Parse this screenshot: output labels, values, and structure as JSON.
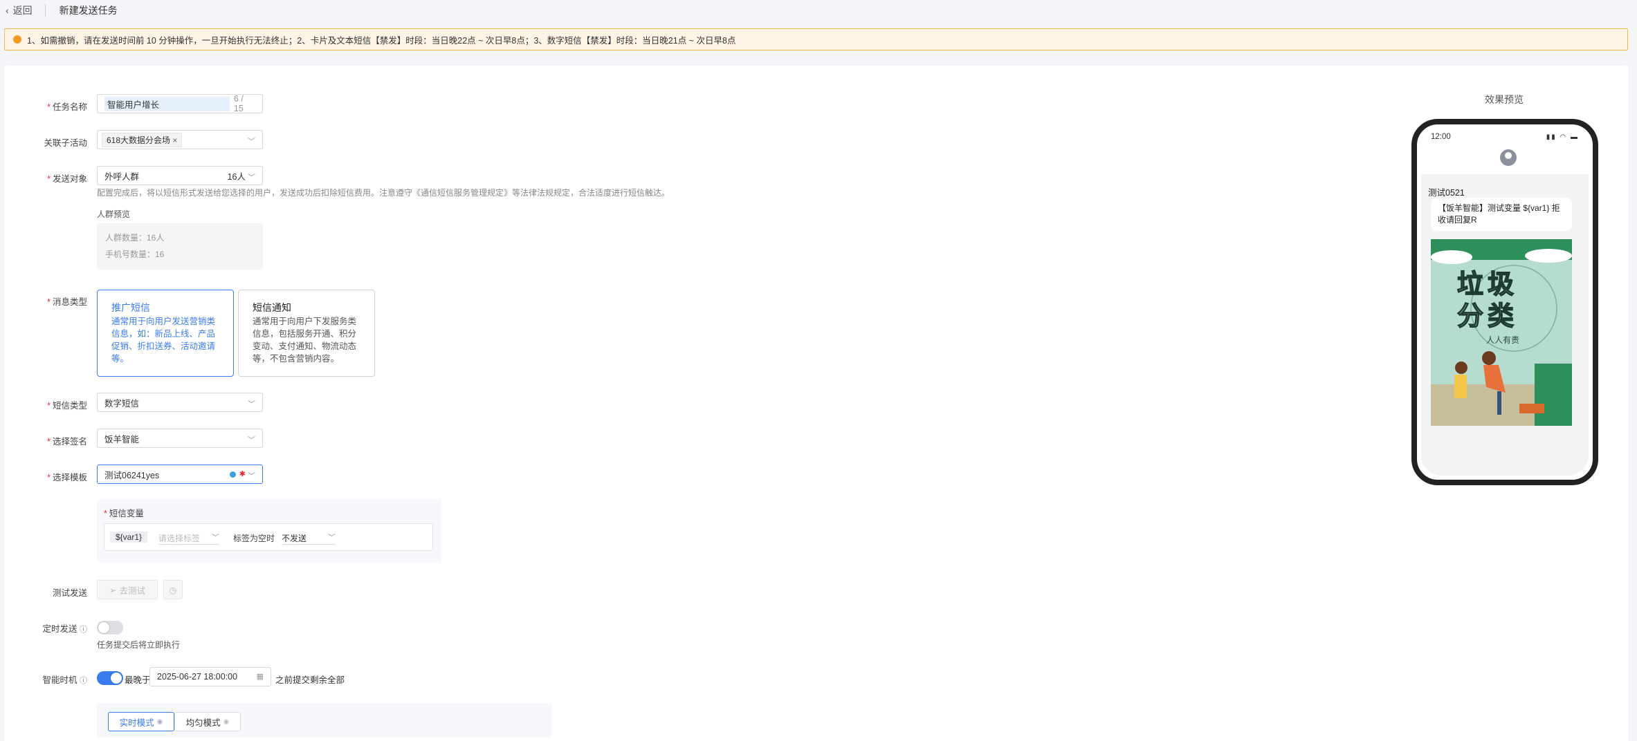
{
  "topbar": {
    "back_label": "返回",
    "title": "新建发送任务"
  },
  "alert": {
    "text": "1、如需撤销，请在发送时间前 10 分钟操作，一旦开始执行无法终止；2、卡片及文本短信【禁发】时段：当日晚22点 ~ 次日早8点；3、数字短信【禁发】时段：当日晚21点 ~ 次日早8点"
  },
  "form": {
    "task_name": {
      "label": "任务名称",
      "value": "智能用户增长",
      "count": "6 / 15"
    },
    "sub_activity": {
      "label": "关联子活动",
      "tag": "618大数据分会场"
    },
    "target": {
      "label": "发送对象",
      "value": "外呼人群",
      "count": "16人",
      "hint": "配置完成后，将以短信形式发送给您选择的用户，发送成功后扣除短信费用。注意遵守《通信短信服务管理规定》等法律法规规定，合法适度进行短信触达。",
      "preview_title": "人群预览",
      "people_count": "人群数量：16人",
      "phone_count": "手机号数量：16"
    },
    "msg_type": {
      "label": "消息类型",
      "options": [
        {
          "title": "推广短信",
          "desc": "通常用于向用户发送营销类信息，如：新品上线、产品促销、折扣送券、活动邀请等。"
        },
        {
          "title": "短信通知",
          "desc": "通常用于向用户下发服务类信息，包括服务开通、积分变动、支付通知、物流动态等，不包含营销内容。"
        }
      ]
    },
    "sms_type": {
      "label": "短信类型",
      "value": "数字短信"
    },
    "signature": {
      "label": "选择签名",
      "value": "饭羊智能"
    },
    "template": {
      "label": "选择模板",
      "value": "测试06241yes"
    },
    "variables": {
      "label": "短信变量",
      "var_name": "${var1}",
      "tag_placeholder": "请选择标签",
      "empty_label": "标签为空时",
      "empty_value": "不发送"
    },
    "test_send": {
      "label": "测试发送",
      "button": "去测试"
    },
    "timed_send": {
      "label": "定时发送",
      "hint": "任务提交后将立即执行"
    },
    "smart_time": {
      "label": "智能时机",
      "prefix": "最晚于",
      "datetime": "2025-06-27 18:00:00",
      "suffix": "之前提交剩余全部"
    },
    "modes": [
      {
        "label": "实时模式"
      },
      {
        "label": "均匀模式"
      }
    ]
  },
  "preview": {
    "title": "效果预览",
    "time": "12:00",
    "sender": "测试0521",
    "message": "【饭羊智能】测试变量 ${var1} 拒收请回复R",
    "poster_big1": "垃圾",
    "poster_big2": "分类"
  },
  "colors": {
    "primary": "#3a7bf0",
    "warning": "#f59a23",
    "required": "#e23333"
  }
}
